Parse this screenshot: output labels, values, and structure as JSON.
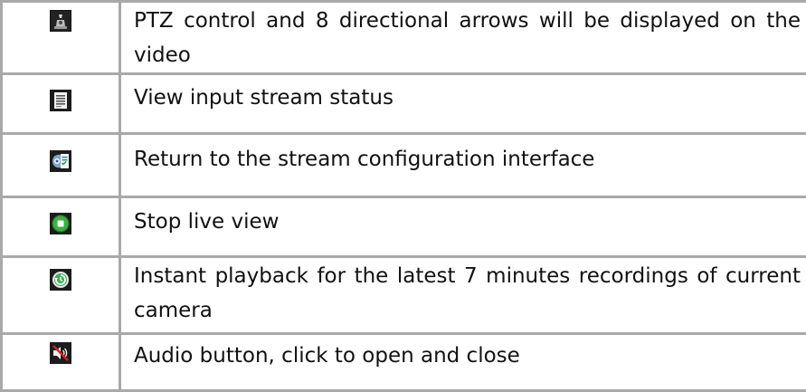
{
  "rows": [
    {
      "icon": "ptz-icon",
      "description": "PTZ control and 8 directional arrows will be displayed on the video"
    },
    {
      "icon": "document-status-icon",
      "description": "View input stream status"
    },
    {
      "icon": "stream-config-icon",
      "description": "Return to the stream configuration interface"
    },
    {
      "icon": "stop-icon",
      "description": "Stop live view"
    },
    {
      "icon": "instant-playback-icon",
      "description": "Instant playback for the latest 7 minutes recordings of current camera"
    },
    {
      "icon": "audio-mute-icon",
      "description": "Audio button, click to open and close"
    }
  ],
  "colors": {
    "border": "#a9a9a9",
    "icon_bg": "#1c1c1c",
    "stop_green": "#3cb043",
    "playback_green": "#3fae5a",
    "mute_red": "#d62020"
  }
}
